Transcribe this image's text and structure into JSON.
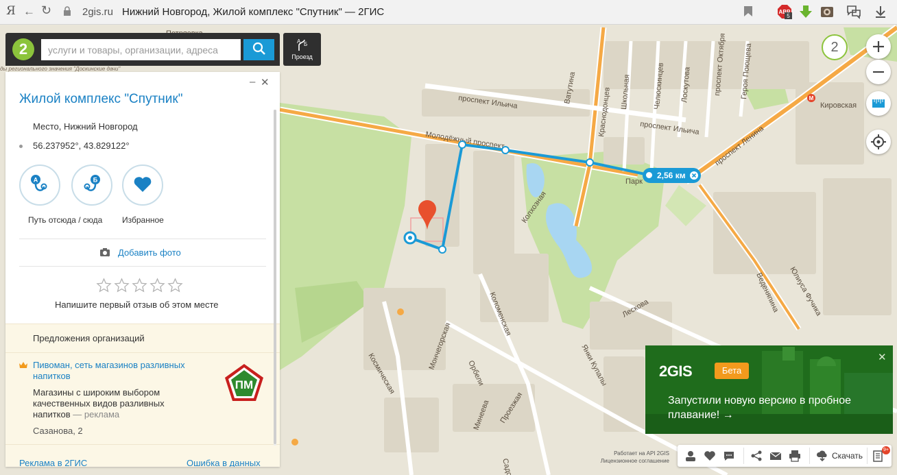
{
  "browser": {
    "brand_glyph": "Я",
    "domain": "2gis.ru",
    "page_title": "Нижний Новгород, Жилой комплекс \"Спутник\" — 2ГИС",
    "ext_badge": "5"
  },
  "search": {
    "logo": "2",
    "placeholder": "услуги и товары, организации, адреса",
    "route_label": "Проезд"
  },
  "region_caption": "ды регионального значения \"Доскинские дачи\"",
  "card": {
    "title": "Жилой комплекс \"Спутник\"",
    "place": "Место, Нижний Новгород",
    "coords": "56.237952°, 43.829122°",
    "route_a": "А",
    "route_b": "Б",
    "route_label": "Путь отсюда / сюда",
    "favorite_label": "Избранное",
    "add_photo": "Добавить фото",
    "rating_stars": 5,
    "review_hint": "Напишите первый отзыв об этом месте",
    "offers_header": "Предложения организаций",
    "offer": {
      "name": "Пивоман, сеть магазинов разливных напитков",
      "description": "Магазины с широким выбором качественных видов разливных напитков",
      "ad_tag": "— реклама",
      "address": "Сазанова, 2",
      "logo_text": "ПМ"
    },
    "footer_left": "Реклама в 2ГИС",
    "footer_right": "Ошибка в данных"
  },
  "map": {
    "zoom_level": "2",
    "distance": "2,56 км",
    "streets": {
      "petryaevka": "Петряевка",
      "ilyicha_1": "проспект Ильича",
      "ilyicha_2": "проспект Ильича",
      "molodezhny": "Молодёжный проспект",
      "vatutina": "Ватутина",
      "krasnodontsev": "Краснодонцев",
      "shkolnaya": "Школьная",
      "chelyuskintsev": "Челюскинцев",
      "loskutova": "Лоскутова",
      "oktyabrya": "проспект Октября",
      "geroya": "Героя Поющева",
      "kirovskaya": "Кировская",
      "lenina": "проспект Ленина",
      "park": "Парк",
      "kolkhoznaya": "Колхозная",
      "kolomenskaya": "Коломенская",
      "monchegorskaya": "Мончегорская",
      "orbeli": "Орбели",
      "kosmicheskaya": "Космическая",
      "leskova": "Лескова",
      "yanki_kupaly": "Янки Купалы",
      "vedenyapina": "Веденяпина",
      "yuliusa_fuchika": "Юлиуса Фучика",
      "mineeva": "Минеева",
      "proezzhaya": "Проезжая",
      "sado": "Садо"
    }
  },
  "banner": {
    "brand": "2GIS",
    "beta": "Бета",
    "message": "Запустили новую версию в пробное плавание! →"
  },
  "toolbar": {
    "download": "Скачать",
    "badge": "9+"
  },
  "api_text": {
    "line1": "Работает на API 2GIS",
    "line2": "Лицензионное соглашение"
  },
  "colors": {
    "accent_blue": "#1a9ad6",
    "link_blue": "#1a81c4",
    "brand_green": "#8cc43c",
    "banner_green": "#1f6c1c",
    "beta_orange": "#f29a1d",
    "pin_red": "#e8502d"
  }
}
